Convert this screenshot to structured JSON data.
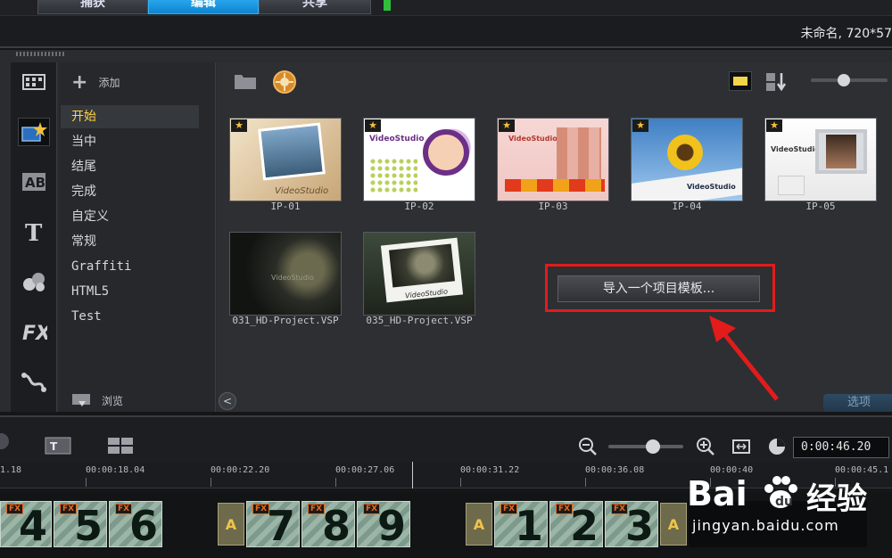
{
  "tabs": [
    "捕获",
    "编辑",
    "共享"
  ],
  "project_info": "未命名, 720*57",
  "categories": {
    "add_label": "添加",
    "browse_label": "浏览",
    "items": [
      "开始",
      "当中",
      "结尾",
      "完成",
      "自定义",
      "常规",
      "Graffiti",
      "HTML5",
      "Test"
    ],
    "selected_index": 0
  },
  "thumbnails": [
    "IP-01",
    "IP-02",
    "IP-03",
    "IP-04",
    "IP-05",
    "031_HD-Project.VSP",
    "035_HD-Project.VSP"
  ],
  "thumb_captions": [
    "VideoStudio",
    "VideoStudio",
    "VideoStudio",
    "VideoStudio",
    "VideoStudio",
    "VideoStudio",
    "VideoStudio"
  ],
  "import_button": "导入一个项目模板...",
  "options_button": "选项",
  "timecode": "0:00:46.20",
  "ruler_ticks": [
    "1.18",
    "00:00:18.04",
    "00:00:22.20",
    "00:00:27.06",
    "00:00:31.22",
    "00:00:36.08",
    "00:00:40",
    "00:00:45.1"
  ],
  "clips": [
    "4",
    "5",
    "6",
    "7",
    "8",
    "9",
    "1",
    "2",
    "3"
  ],
  "fx_label": "FX",
  "transition_label": "A",
  "watermark": {
    "brand": "Bai",
    "brand2": "经验",
    "url": "jingyan.baidu.com"
  },
  "colors": {
    "accent": "#0d84cf",
    "highlight_box": "#e31b1b",
    "selected_text": "#ffd24a"
  }
}
